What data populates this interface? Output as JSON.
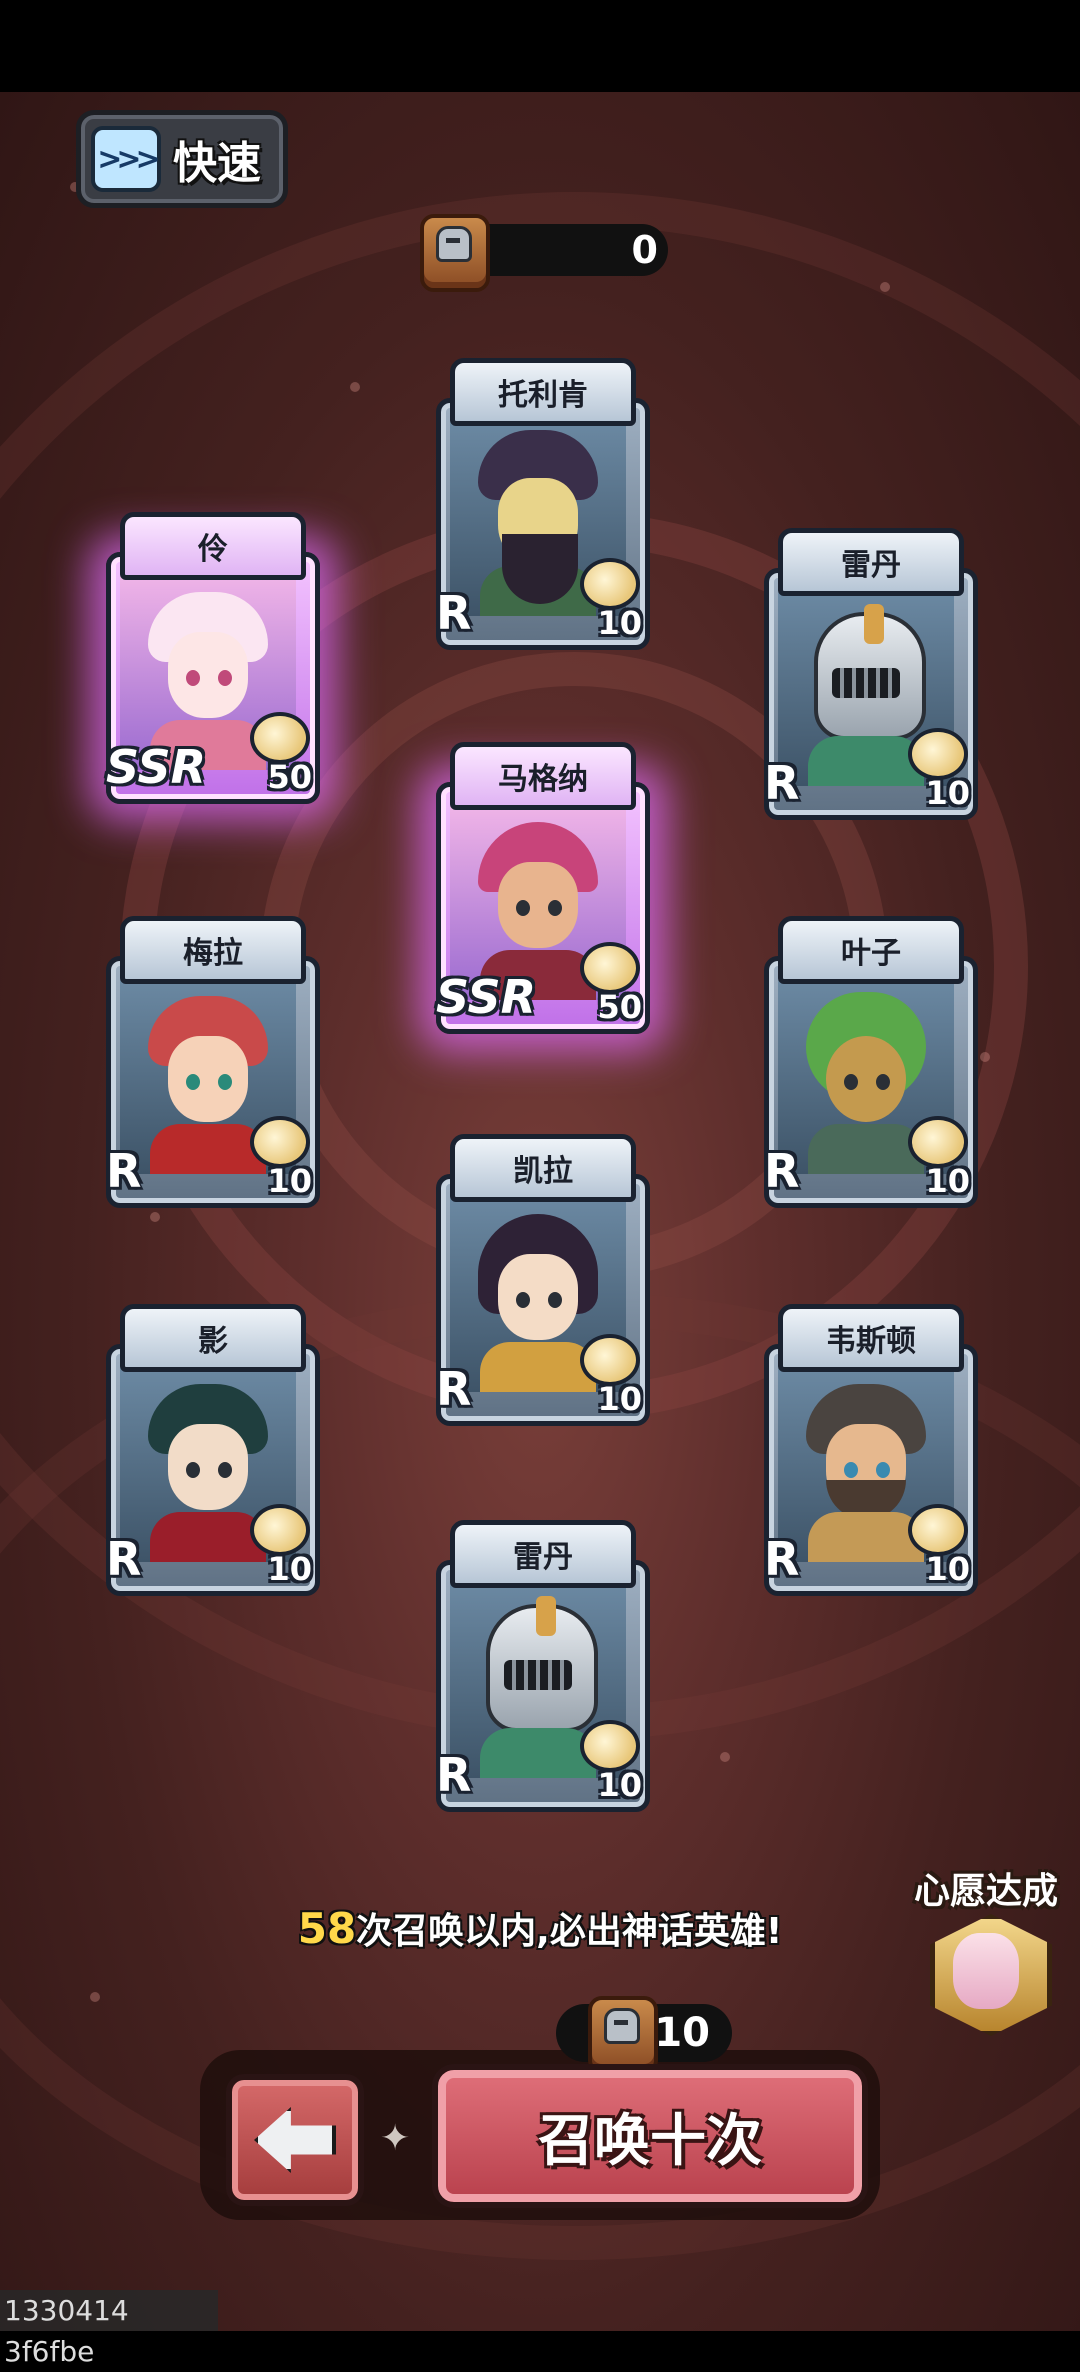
{
  "quick_button": {
    "label": "快速",
    "icon": "fast-forward-icon"
  },
  "top_counter": {
    "icon": "summon-token-icon",
    "value": "0"
  },
  "cards": [
    {
      "name": "托利肯",
      "rarity": "R",
      "cost": "10"
    },
    {
      "name": "伶",
      "rarity": "SSR",
      "cost": "50"
    },
    {
      "name": "雷丹",
      "rarity": "R",
      "cost": "10"
    },
    {
      "name": "马格纳",
      "rarity": "SSR",
      "cost": "50"
    },
    {
      "name": "梅拉",
      "rarity": "R",
      "cost": "10"
    },
    {
      "name": "叶子",
      "rarity": "R",
      "cost": "10"
    },
    {
      "name": "凯拉",
      "rarity": "R",
      "cost": "10"
    },
    {
      "name": "影",
      "rarity": "R",
      "cost": "10"
    },
    {
      "name": "韦斯顿",
      "rarity": "R",
      "cost": "10"
    },
    {
      "name": "雷丹",
      "rarity": "R",
      "cost": "10"
    }
  ],
  "hint": {
    "count": "58",
    "text": "次召唤以内,必出神话英雄!"
  },
  "wish": {
    "label": "心愿达成"
  },
  "summon": {
    "cost": "10",
    "label": "召唤十次",
    "back_icon": "back-arrow-icon"
  },
  "watermark": "1330414 3f6fbe",
  "colors": {
    "accent_red": "#c44a56",
    "ssr_glow": "#e66eff",
    "hint_number": "#ffd84a"
  }
}
